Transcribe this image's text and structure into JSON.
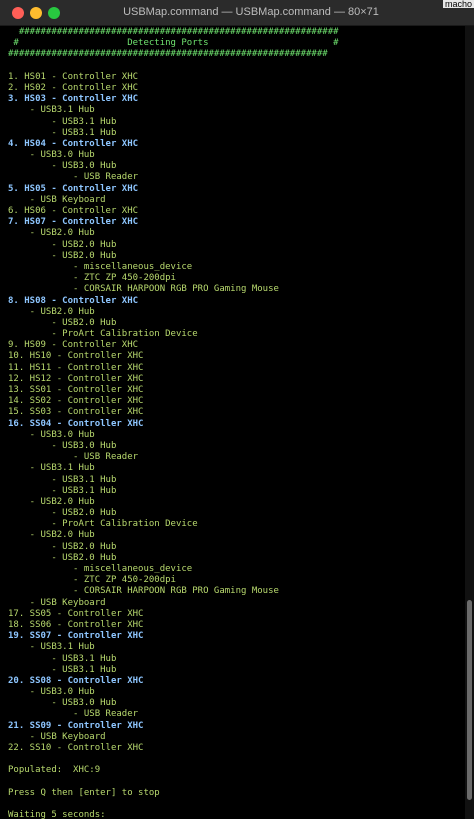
{
  "window": {
    "title": "USBMap.command — USBMap.command — 80×71",
    "corner_tag": "macho"
  },
  "terminal": {
    "lines": [
      {
        "text": "  ###########################################################",
        "style": "hdr"
      },
      {
        "text": " #                    Detecting Ports                       #",
        "style": "hdr"
      },
      {
        "text": "###########################################################",
        "style": "hdr"
      },
      {
        "text": "",
        "style": ""
      },
      {
        "text": "1. HS01 - Controller XHC",
        "style": ""
      },
      {
        "text": "2. HS02 - Controller XHC",
        "style": ""
      },
      {
        "text": "3. HS03 - Controller XHC",
        "style": "bold"
      },
      {
        "text": "    - USB3.1 Hub",
        "style": ""
      },
      {
        "text": "        - USB3.1 Hub",
        "style": ""
      },
      {
        "text": "        - USB3.1 Hub",
        "style": ""
      },
      {
        "text": "4. HS04 - Controller XHC",
        "style": "bold"
      },
      {
        "text": "    - USB3.0 Hub",
        "style": ""
      },
      {
        "text": "        - USB3.0 Hub",
        "style": ""
      },
      {
        "text": "            - USB Reader",
        "style": ""
      },
      {
        "text": "5. HS05 - Controller XHC",
        "style": "bold"
      },
      {
        "text": "    - USB Keyboard",
        "style": ""
      },
      {
        "text": "6. HS06 - Controller XHC",
        "style": ""
      },
      {
        "text": "7. HS07 - Controller XHC",
        "style": "bold"
      },
      {
        "text": "    - USB2.0 Hub",
        "style": ""
      },
      {
        "text": "        - USB2.0 Hub",
        "style": ""
      },
      {
        "text": "        - USB2.0 Hub",
        "style": ""
      },
      {
        "text": "            - miscellaneous_device",
        "style": ""
      },
      {
        "text": "            - ZTC ZP 450-200dpi",
        "style": ""
      },
      {
        "text": "            - CORSAIR HARPOON RGB PRO Gaming Mouse",
        "style": ""
      },
      {
        "text": "8. HS08 - Controller XHC",
        "style": "bold"
      },
      {
        "text": "    - USB2.0 Hub",
        "style": ""
      },
      {
        "text": "        - USB2.0 Hub",
        "style": ""
      },
      {
        "text": "        - ProArt Calibration Device",
        "style": ""
      },
      {
        "text": "9. HS09 - Controller XHC",
        "style": ""
      },
      {
        "text": "10. HS10 - Controller XHC",
        "style": ""
      },
      {
        "text": "11. HS11 - Controller XHC",
        "style": ""
      },
      {
        "text": "12. HS12 - Controller XHC",
        "style": ""
      },
      {
        "text": "13. SS01 - Controller XHC",
        "style": ""
      },
      {
        "text": "14. SS02 - Controller XHC",
        "style": ""
      },
      {
        "text": "15. SS03 - Controller XHC",
        "style": ""
      },
      {
        "text": "16. SS04 - Controller XHC",
        "style": "bold"
      },
      {
        "text": "    - USB3.0 Hub",
        "style": ""
      },
      {
        "text": "        - USB3.0 Hub",
        "style": ""
      },
      {
        "text": "            - USB Reader",
        "style": ""
      },
      {
        "text": "    - USB3.1 Hub",
        "style": ""
      },
      {
        "text": "        - USB3.1 Hub",
        "style": ""
      },
      {
        "text": "        - USB3.1 Hub",
        "style": ""
      },
      {
        "text": "    - USB2.0 Hub",
        "style": ""
      },
      {
        "text": "        - USB2.0 Hub",
        "style": ""
      },
      {
        "text": "        - ProArt Calibration Device",
        "style": ""
      },
      {
        "text": "    - USB2.0 Hub",
        "style": ""
      },
      {
        "text": "        - USB2.0 Hub",
        "style": ""
      },
      {
        "text": "        - USB2.0 Hub",
        "style": ""
      },
      {
        "text": "            - miscellaneous_device",
        "style": ""
      },
      {
        "text": "            - ZTC ZP 450-200dpi",
        "style": ""
      },
      {
        "text": "            - CORSAIR HARPOON RGB PRO Gaming Mouse",
        "style": ""
      },
      {
        "text": "    - USB Keyboard",
        "style": ""
      },
      {
        "text": "17. SS05 - Controller XHC",
        "style": ""
      },
      {
        "text": "18. SS06 - Controller XHC",
        "style": ""
      },
      {
        "text": "19. SS07 - Controller XHC",
        "style": "bold"
      },
      {
        "text": "    - USB3.1 Hub",
        "style": ""
      },
      {
        "text": "        - USB3.1 Hub",
        "style": ""
      },
      {
        "text": "        - USB3.1 Hub",
        "style": ""
      },
      {
        "text": "20. SS08 - Controller XHC",
        "style": "bold"
      },
      {
        "text": "    - USB3.0 Hub",
        "style": ""
      },
      {
        "text": "        - USB3.0 Hub",
        "style": ""
      },
      {
        "text": "            - USB Reader",
        "style": ""
      },
      {
        "text": "21. SS09 - Controller XHC",
        "style": "bold"
      },
      {
        "text": "    - USB Keyboard",
        "style": ""
      },
      {
        "text": "22. SS10 - Controller XHC",
        "style": ""
      },
      {
        "text": "",
        "style": ""
      },
      {
        "text": "Populated:  XHC:9",
        "style": ""
      },
      {
        "text": "",
        "style": ""
      },
      {
        "text": "Press Q then [enter] to stop",
        "style": ""
      },
      {
        "text": "",
        "style": ""
      },
      {
        "text": "Waiting 5 seconds:",
        "style": ""
      }
    ]
  },
  "colors": {
    "background": "#000000",
    "text_green": "#b8d96e",
    "header_green": "#6ee16e",
    "bold_blue": "#8ec6ff"
  }
}
